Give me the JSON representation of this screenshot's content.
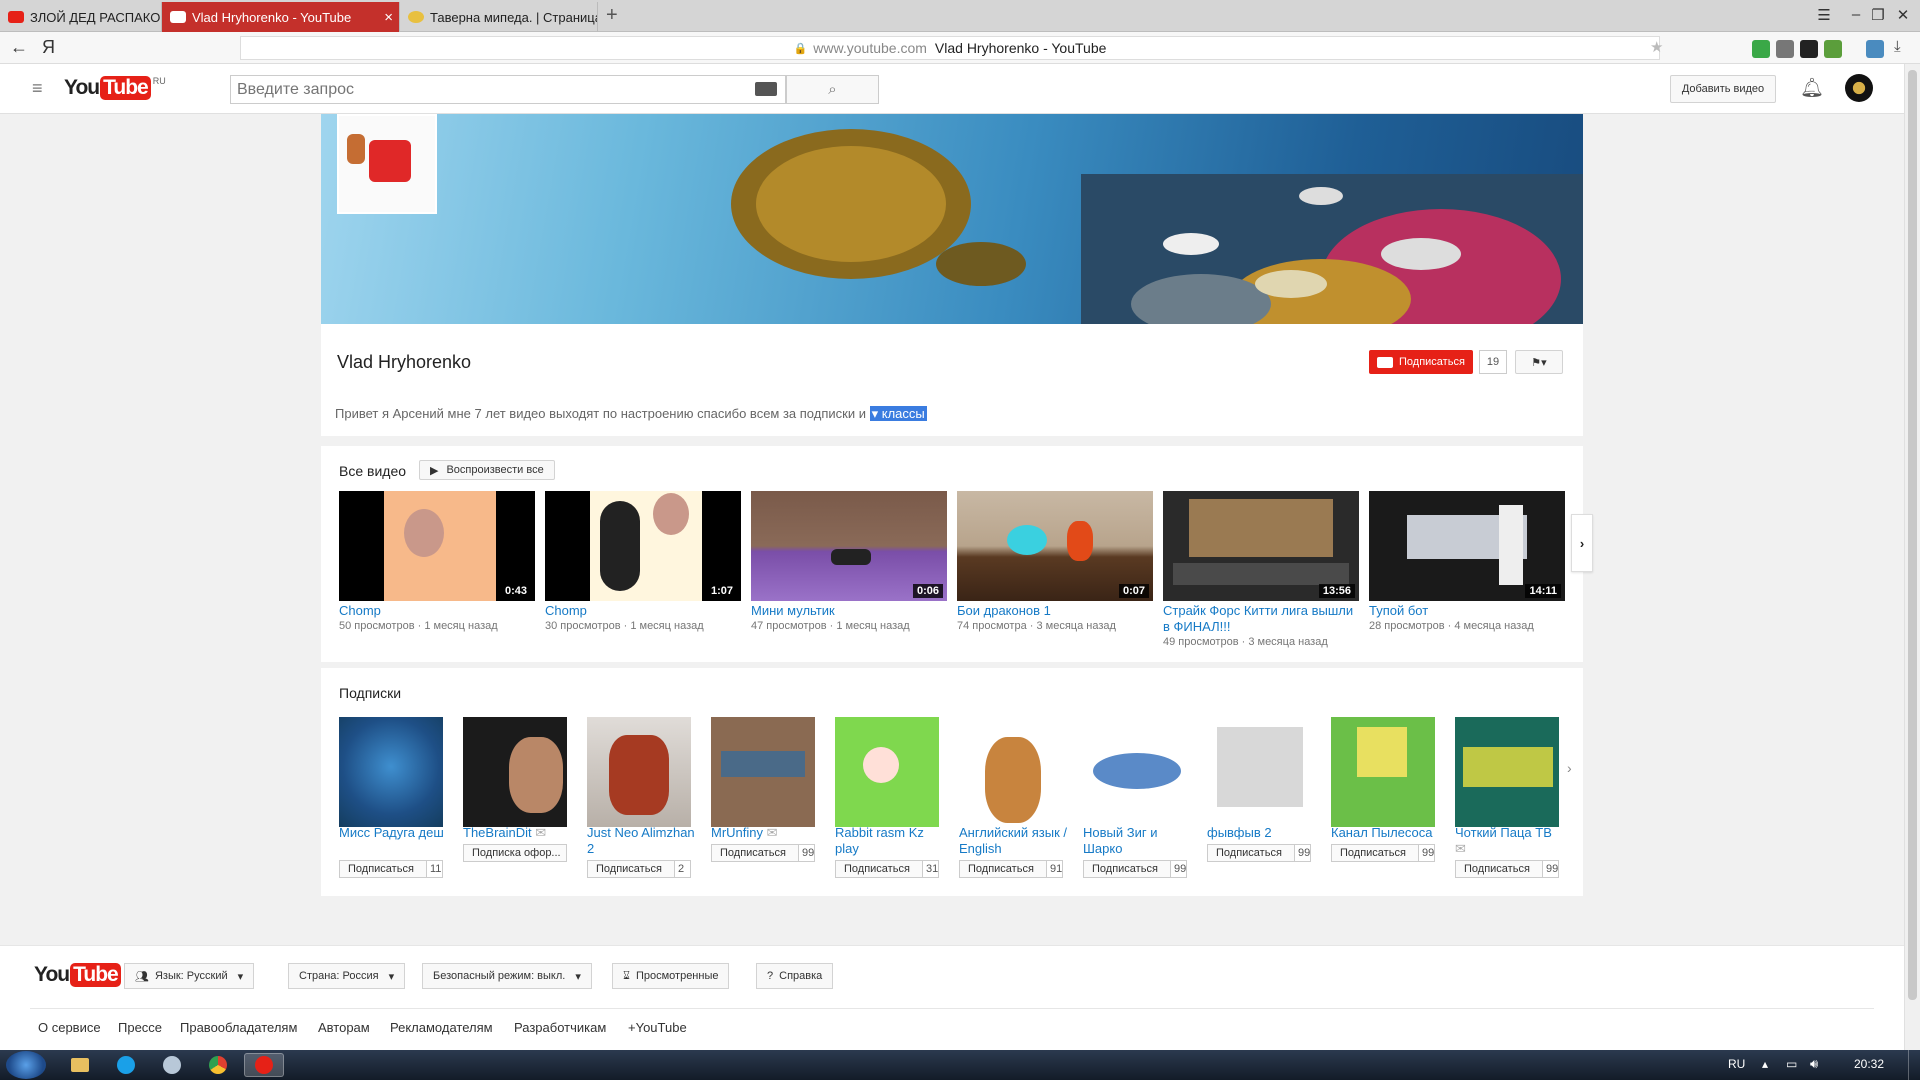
{
  "browser": {
    "tabs": [
      {
        "title": "ЗЛОЙ ДЕД РАСПАКОВЫВАЕТ",
        "icon": "youtube-icon"
      },
      {
        "title": "Vlad Hryhorenko - YouTube",
        "icon": "youtube-icon"
      },
      {
        "title": "Таверна мипеда. | Страница",
        "icon": "pony-icon"
      }
    ],
    "new_tab": "+",
    "back": "←",
    "yandex_logo": "Я",
    "url_domain": "www.youtube.com",
    "url_title": "Vlad Hryhorenko - YouTube",
    "accent": "#c4302b"
  },
  "header": {
    "logo_you": "You",
    "logo_tube": "Tube",
    "logo_region": "RU",
    "search_placeholder": "Введите запрос",
    "upload_label": "Добавить видео"
  },
  "channel": {
    "name": "Vlad Hryhorenko",
    "subscribe_label": "Подписаться",
    "subscriber_count": "19",
    "description": "Привет я Арсений мне 7 лет видео выходят по настроению спасибо всем за подписки и",
    "description_link": "классы"
  },
  "videos_section": {
    "title": "Все видео",
    "play_all": "Воспроизвести все",
    "items": [
      {
        "title": "Chomp",
        "views": "50 просмотров",
        "age": "1 месяц назад",
        "duration": "0:43"
      },
      {
        "title": "Chomp",
        "views": "30 просмотров",
        "age": "1 месяц назад",
        "duration": "1:07"
      },
      {
        "title": "Мини мультик",
        "views": "47 просмотров",
        "age": "1 месяц назад",
        "duration": "0:06"
      },
      {
        "title": "Бои драконов 1",
        "views": "74 просмотра",
        "age": "3 месяца назад",
        "duration": "0:07"
      },
      {
        "title": "Страйк Форс Китти лига вышли в ФИНАЛ!!!",
        "views": "49 просмотров",
        "age": "3 месяца назад",
        "duration": "13:56"
      },
      {
        "title": "Тупой бот",
        "views": "28 просмотров",
        "age": "4 месяца назад",
        "duration": "14:11"
      }
    ]
  },
  "subs_section": {
    "title": "Подписки",
    "items": [
      {
        "name": "Мисс Радуга деш",
        "button": "Подписаться",
        "count": "11"
      },
      {
        "name": "TheBrainDit",
        "button": "Подписка офор...",
        "count": ""
      },
      {
        "name": "Just Neo Alimzhan 2",
        "button": "Подписаться",
        "count": "2"
      },
      {
        "name": "MrUnfiny",
        "button": "Подписаться",
        "count": "99"
      },
      {
        "name": "Rabbit rasm Kz play",
        "button": "Подписаться",
        "count": "31"
      },
      {
        "name": "Английский язык / English",
        "button": "Подписаться",
        "count": "91"
      },
      {
        "name": "Новый Зиг и Шарко",
        "button": "Подписаться",
        "count": "99"
      },
      {
        "name": "фывфыв 2",
        "button": "Подписаться",
        "count": "99"
      },
      {
        "name": "Канал Пылесоса",
        "button": "Подписаться",
        "count": "99"
      },
      {
        "name": "Чоткий Паца ТВ",
        "button": "Подписаться",
        "count": "99"
      }
    ]
  },
  "footer": {
    "language": "Язык: Русский",
    "country": "Страна: Россия",
    "safety": "Безопасный режим: выкл.",
    "history": "Просмотренные",
    "help": "Справка",
    "links": [
      "О сервисе",
      "Прессе",
      "Правообладателям",
      "Авторам",
      "Рекламодателям",
      "Разработчикам",
      "+YouTube"
    ]
  },
  "taskbar": {
    "lang": "RU",
    "time": "20:32"
  }
}
